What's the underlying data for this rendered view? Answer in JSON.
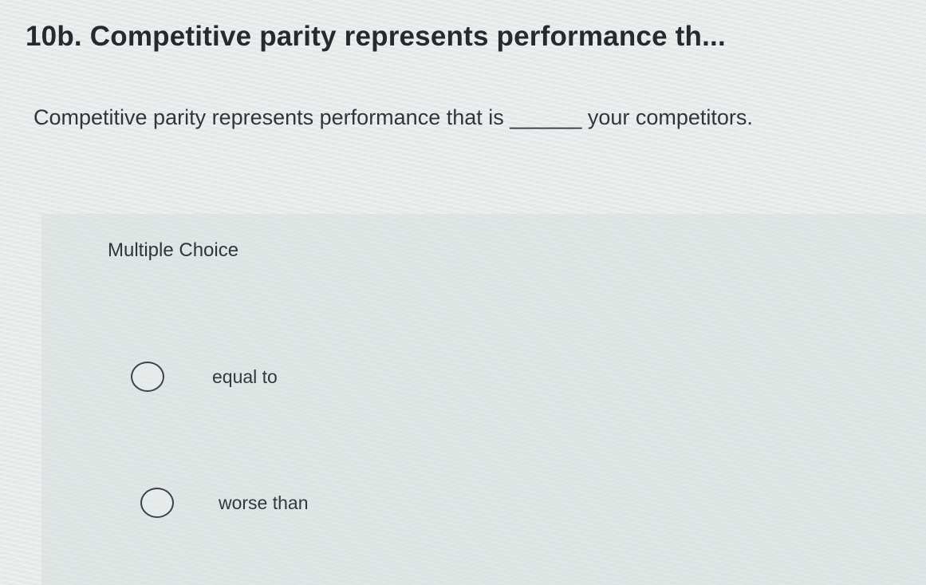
{
  "question": {
    "title": "10b. Competitive parity represents performance th...",
    "prompt": "Competitive parity represents performance that is ______ your competitors."
  },
  "choices": {
    "heading": "Multiple Choice",
    "options": [
      {
        "label": "equal to",
        "selected": false
      },
      {
        "label": "worse than",
        "selected": false
      }
    ]
  }
}
